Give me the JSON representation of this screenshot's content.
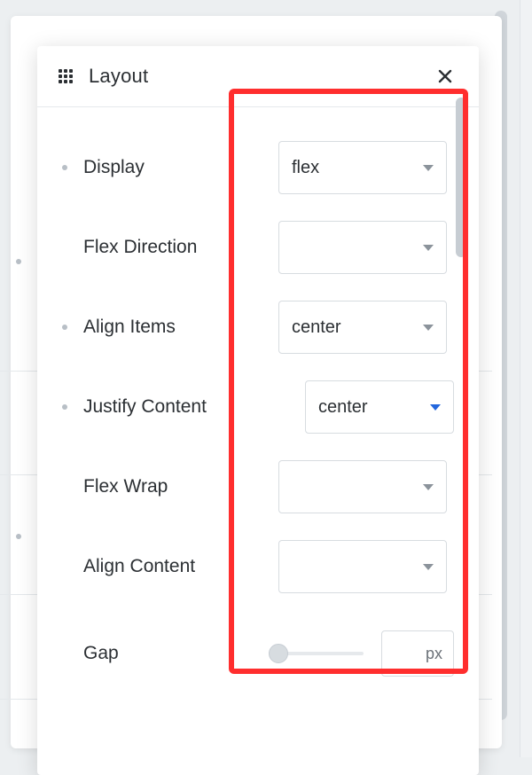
{
  "panel": {
    "title": "Layout",
    "rows": [
      {
        "label": "Display",
        "value": "flex",
        "hasDot": true,
        "indent": false,
        "active": false
      },
      {
        "label": "Flex Direction",
        "value": "",
        "hasDot": false,
        "indent": false,
        "active": false
      },
      {
        "label": "Align Items",
        "value": "center",
        "hasDot": true,
        "indent": false,
        "active": false
      },
      {
        "label": "Justify Content",
        "value": "center",
        "hasDot": true,
        "indent": true,
        "active": true
      },
      {
        "label": "Flex Wrap",
        "value": "",
        "hasDot": false,
        "indent": false,
        "active": false
      },
      {
        "label": "Align Content",
        "value": "",
        "hasDot": false,
        "indent": false,
        "active": false
      }
    ],
    "gap": {
      "label": "Gap",
      "unit": "px"
    }
  }
}
